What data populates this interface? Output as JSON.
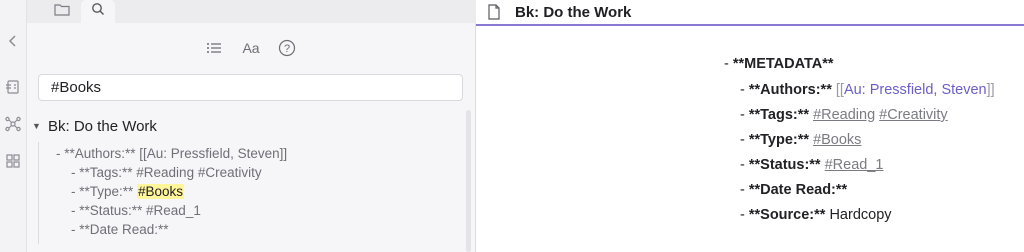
{
  "left_panel": {
    "tabs": [
      {
        "name": "files",
        "icon": "folder-icon"
      },
      {
        "name": "search",
        "icon": "search-icon"
      }
    ],
    "search_value": "#Books",
    "result": {
      "file": "Bk: Do the Work",
      "matches": [
        {
          "before": "- **Authors:** [[Au: Pressfield, Steven]]",
          "highlight": "",
          "after": ""
        },
        {
          "before": "- **Tags:** #Reading #Creativity",
          "highlight": "",
          "after": ""
        },
        {
          "before": "- **Type:** ",
          "highlight": "#Books",
          "after": ""
        },
        {
          "before": "- **Status:** #Read_1",
          "highlight": "",
          "after": ""
        },
        {
          "before": "- **Date Read:**",
          "highlight": "",
          "after": ""
        }
      ]
    }
  },
  "editor": {
    "title": "Bk: Do the Work",
    "metadata_line": {
      "dash": "- ",
      "label": "**METADATA**"
    },
    "authors": {
      "dash": "- ",
      "label": "**Authors:**",
      "open": "[[",
      "link": "Au: Pressfield, Steven",
      "close": "]]"
    },
    "tags": {
      "dash": "- ",
      "label": "**Tags:**",
      "tag1": "#Reading",
      "tag2": "#Creativity"
    },
    "type": {
      "dash": "- ",
      "label": "**Type:**",
      "tag": "#Books"
    },
    "status": {
      "dash": "- ",
      "label": "**Status:**",
      "tag": "#Read_1"
    },
    "date_read": {
      "dash": "- ",
      "label": "**Date Read:**"
    },
    "source": {
      "dash": "- ",
      "label": "**Source:**",
      "value": "Hardcopy"
    }
  },
  "colors": {
    "accent": "#8a7ad6",
    "link": "#6c5ec8",
    "highlight": "#fff59a"
  }
}
